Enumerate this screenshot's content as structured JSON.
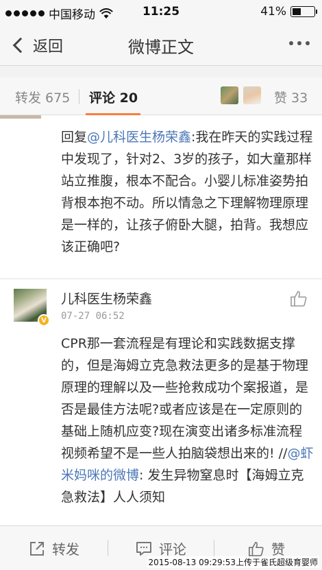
{
  "status_bar": {
    "carrier": "中国移动",
    "time": "11:25",
    "battery": "41%",
    "battery_level": 0.41
  },
  "nav": {
    "back_label": "返回",
    "title": "微博正文",
    "more_icon": "more-icon"
  },
  "tabs": {
    "repost": "转发 675",
    "comment": "评论 20",
    "like": "赞 33"
  },
  "reply": {
    "prefix": "回复",
    "mention": "@儿科医生杨荣鑫",
    "text": ":我在昨天的实践过程中发现了，针对2、3岁的孩子，如大童那样站立推腹，根本不配合。小婴儿标准姿势拍背根本抱不动。所以情急之下理解物理原理是一样的，让孩子俯卧大腿，拍背。我想应该正确吧?"
  },
  "comment": {
    "username": "儿科医生杨荣鑫",
    "timestamp": "07-27 06:52",
    "text_before": "CPR那一套流程是有理论和实践数据支撑的，但是海姆立克急救法更多的是基于物理原理的理解以及一些抢救成功个案报道，是否是最佳方法呢?或者应该是在一定原则的基础上随机应变?现在演变出诸多标准流程视频希望不是一些人拍脑袋想出来的! //",
    "mention": "@虾米妈咪的微博",
    "text_after": ": 发生异物窒息时【海姆立克急救法】人人须知"
  },
  "toolbar": {
    "repost": "转发",
    "comment": "评论",
    "like": "赞"
  },
  "watermark": "2015-08-13 09:29:53上传于雀氏超级育婴师"
}
